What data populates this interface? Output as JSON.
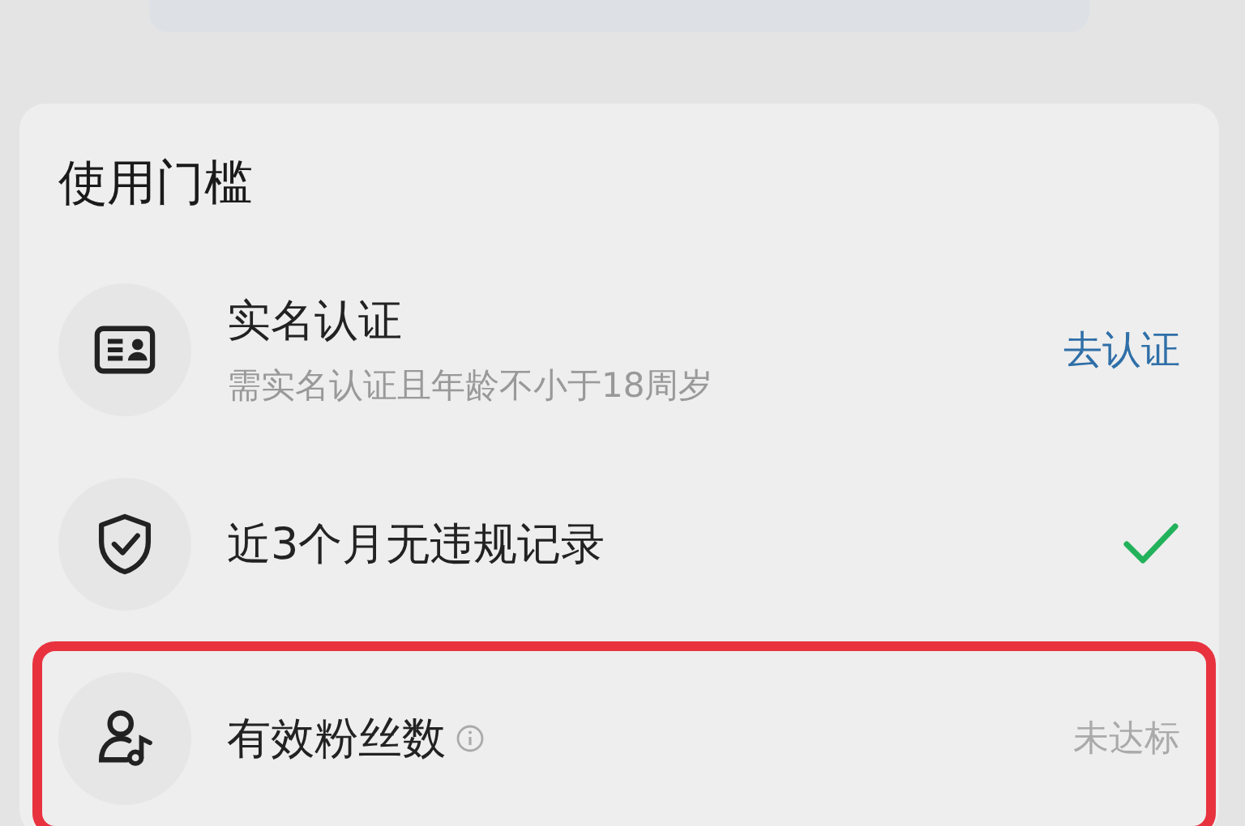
{
  "section": {
    "title": "使用门槛",
    "items": [
      {
        "title": "实名认证",
        "subtitle": "需实名认证且年龄不小于18周岁",
        "kind": "action",
        "action": "去认证",
        "highlighted": false,
        "info": false
      },
      {
        "title": "近3个月无违规记录",
        "kind": "check",
        "highlighted": false,
        "info": false
      },
      {
        "title": "有效粉丝数",
        "kind": "status",
        "status": "未达标",
        "highlighted": true,
        "info": true
      }
    ]
  }
}
